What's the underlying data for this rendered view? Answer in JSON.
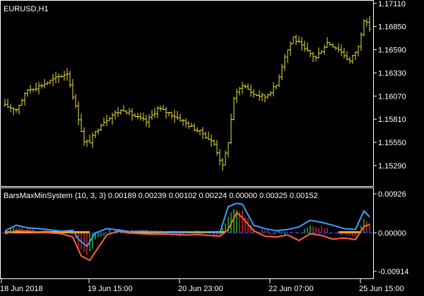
{
  "chart_data": [
    {
      "type": "ohlc",
      "title": "EURUSD,H1",
      "colors": {
        "bars": "#e8e040",
        "frame": "#ffffff",
        "background": "#000000"
      },
      "ylim": [
        1.1506,
        1.1714
      ],
      "y_ticks": [
        "1.17110",
        "1.16850",
        "1.16590",
        "1.16330",
        "1.16070",
        "1.15810",
        "1.15550",
        "1.15290"
      ],
      "x_ticks": [
        "18 Jun 2018",
        "19 Jun 15:00",
        "20 Jun 23:00",
        "22 Jun 07:00",
        "25 Jun 15:00"
      ],
      "x_tick_bar_index": [
        0,
        31,
        63,
        95,
        127
      ],
      "bar_count": 130,
      "anchors": {
        "bar_index": [
          0,
          4,
          8,
          12,
          16,
          22,
          26,
          28,
          30,
          34,
          38,
          42,
          46,
          50,
          54,
          58,
          62,
          66,
          70,
          74,
          77,
          79,
          81,
          84,
          88,
          92,
          96,
          99,
          102,
          106,
          110,
          114,
          118,
          122,
          125,
          127,
          129
        ],
        "close": [
          1.1596,
          1.1592,
          1.1614,
          1.1618,
          1.1624,
          1.1633,
          1.1582,
          1.1555,
          1.1556,
          1.1576,
          1.1586,
          1.1592,
          1.1584,
          1.1578,
          1.1593,
          1.1588,
          1.1581,
          1.1572,
          1.1565,
          1.1553,
          1.1528,
          1.1556,
          1.1605,
          1.162,
          1.1609,
          1.1606,
          1.1619,
          1.1652,
          1.1673,
          1.1659,
          1.165,
          1.1667,
          1.166,
          1.1646,
          1.1662,
          1.1693,
          1.1683
        ]
      }
    },
    {
      "type": "line",
      "title": "BarsMaxMinSystem (10, 3, 3) 0.00189 0.00239 0.00102 0.00224 0.00000 0.00325 0.00152",
      "colors": {
        "upper": "#3aa0ff",
        "lower": "#ff6040",
        "level": "#ffa020",
        "zero": "#2840ff",
        "hist_up": "#28c828",
        "hist_down": "#e02828"
      },
      "ylim": [
        -0.0108,
        0.0106
      ],
      "y_ticks": [
        "0.00926",
        "0.00000",
        "-0.00914"
      ],
      "series": [
        {
          "key": "upper",
          "anchors": {
            "bar_index": [
              0,
              4,
              8,
              12,
              16,
              20,
              24,
              26,
              29,
              32,
              36,
              40,
              44,
              48,
              52,
              56,
              60,
              64,
              68,
              72,
              76,
              79,
              82,
              84,
              88,
              92,
              96,
              100,
              104,
              108,
              112,
              116,
              120,
              124,
              127,
              129
            ],
            "values": [
              0.0005,
              0.0018,
              0.0012,
              0.001,
              0.0007,
              0.0004,
              0.0006,
              -0.0015,
              -0.0032,
              0.0,
              0.001,
              0.0007,
              0.0003,
              0.0004,
              0.0003,
              0.0002,
              0.0001,
              0.0002,
              0.0003,
              0.0002,
              0.0,
              0.0062,
              0.007,
              0.0068,
              0.0018,
              0.001,
              0.0005,
              0.0008,
              0.0014,
              0.003,
              0.0025,
              0.0018,
              0.001,
              0.0008,
              0.0052,
              0.0038
            ]
          }
        },
        {
          "key": "lower",
          "anchors": {
            "bar_index": [
              0,
              4,
              8,
              12,
              16,
              20,
              24,
              27,
              30,
              33,
              36,
              40,
              44,
              48,
              52,
              56,
              60,
              64,
              68,
              72,
              76,
              79,
              82,
              84,
              88,
              92,
              96,
              100,
              104,
              108,
              112,
              116,
              120,
              124,
              127,
              129
            ],
            "values": [
              -0.0002,
              0.0005,
              0.0004,
              0.0002,
              0.0,
              -0.0002,
              -0.001,
              -0.0055,
              -0.0065,
              -0.0035,
              -0.0005,
              0.0004,
              0.0,
              -0.0002,
              -0.0003,
              -0.0003,
              -0.0004,
              -0.0005,
              -0.0004,
              -0.0006,
              -0.0008,
              0.0008,
              0.0048,
              0.0036,
              0.0005,
              -0.0008,
              -0.001,
              -0.0005,
              -0.0018,
              -0.0002,
              -0.0006,
              -0.0015,
              -0.0012,
              -0.0016,
              0.0015,
              0.002
            ]
          }
        }
      ],
      "level_segments": [
        [
          0,
          30
        ],
        [
          44,
          78
        ],
        [
          118,
          126
        ]
      ],
      "zero_line": 0.0
    }
  ]
}
